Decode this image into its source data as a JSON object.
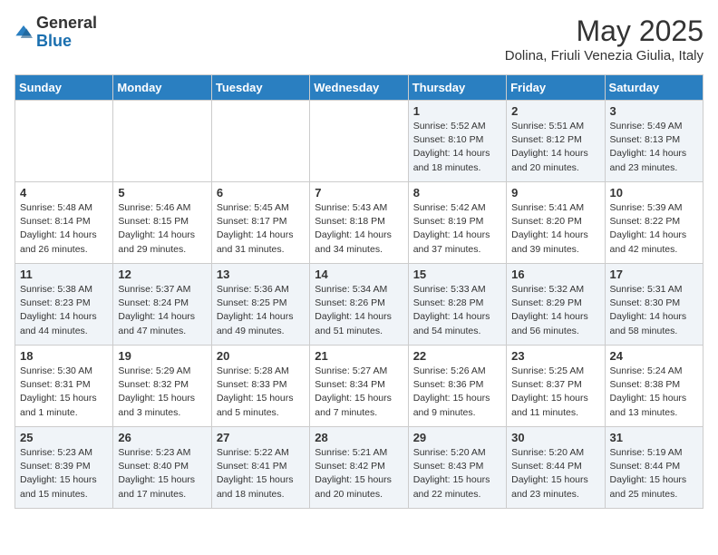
{
  "logo": {
    "general": "General",
    "blue": "Blue"
  },
  "title": "May 2025",
  "subtitle": "Dolina, Friuli Venezia Giulia, Italy",
  "days_of_week": [
    "Sunday",
    "Monday",
    "Tuesday",
    "Wednesday",
    "Thursday",
    "Friday",
    "Saturday"
  ],
  "weeks": [
    [
      {
        "day": "",
        "content": ""
      },
      {
        "day": "",
        "content": ""
      },
      {
        "day": "",
        "content": ""
      },
      {
        "day": "",
        "content": ""
      },
      {
        "day": "1",
        "content": "Sunrise: 5:52 AM\nSunset: 8:10 PM\nDaylight: 14 hours\nand 18 minutes."
      },
      {
        "day": "2",
        "content": "Sunrise: 5:51 AM\nSunset: 8:12 PM\nDaylight: 14 hours\nand 20 minutes."
      },
      {
        "day": "3",
        "content": "Sunrise: 5:49 AM\nSunset: 8:13 PM\nDaylight: 14 hours\nand 23 minutes."
      }
    ],
    [
      {
        "day": "4",
        "content": "Sunrise: 5:48 AM\nSunset: 8:14 PM\nDaylight: 14 hours\nand 26 minutes."
      },
      {
        "day": "5",
        "content": "Sunrise: 5:46 AM\nSunset: 8:15 PM\nDaylight: 14 hours\nand 29 minutes."
      },
      {
        "day": "6",
        "content": "Sunrise: 5:45 AM\nSunset: 8:17 PM\nDaylight: 14 hours\nand 31 minutes."
      },
      {
        "day": "7",
        "content": "Sunrise: 5:43 AM\nSunset: 8:18 PM\nDaylight: 14 hours\nand 34 minutes."
      },
      {
        "day": "8",
        "content": "Sunrise: 5:42 AM\nSunset: 8:19 PM\nDaylight: 14 hours\nand 37 minutes."
      },
      {
        "day": "9",
        "content": "Sunrise: 5:41 AM\nSunset: 8:20 PM\nDaylight: 14 hours\nand 39 minutes."
      },
      {
        "day": "10",
        "content": "Sunrise: 5:39 AM\nSunset: 8:22 PM\nDaylight: 14 hours\nand 42 minutes."
      }
    ],
    [
      {
        "day": "11",
        "content": "Sunrise: 5:38 AM\nSunset: 8:23 PM\nDaylight: 14 hours\nand 44 minutes."
      },
      {
        "day": "12",
        "content": "Sunrise: 5:37 AM\nSunset: 8:24 PM\nDaylight: 14 hours\nand 47 minutes."
      },
      {
        "day": "13",
        "content": "Sunrise: 5:36 AM\nSunset: 8:25 PM\nDaylight: 14 hours\nand 49 minutes."
      },
      {
        "day": "14",
        "content": "Sunrise: 5:34 AM\nSunset: 8:26 PM\nDaylight: 14 hours\nand 51 minutes."
      },
      {
        "day": "15",
        "content": "Sunrise: 5:33 AM\nSunset: 8:28 PM\nDaylight: 14 hours\nand 54 minutes."
      },
      {
        "day": "16",
        "content": "Sunrise: 5:32 AM\nSunset: 8:29 PM\nDaylight: 14 hours\nand 56 minutes."
      },
      {
        "day": "17",
        "content": "Sunrise: 5:31 AM\nSunset: 8:30 PM\nDaylight: 14 hours\nand 58 minutes."
      }
    ],
    [
      {
        "day": "18",
        "content": "Sunrise: 5:30 AM\nSunset: 8:31 PM\nDaylight: 15 hours\nand 1 minute."
      },
      {
        "day": "19",
        "content": "Sunrise: 5:29 AM\nSunset: 8:32 PM\nDaylight: 15 hours\nand 3 minutes."
      },
      {
        "day": "20",
        "content": "Sunrise: 5:28 AM\nSunset: 8:33 PM\nDaylight: 15 hours\nand 5 minutes."
      },
      {
        "day": "21",
        "content": "Sunrise: 5:27 AM\nSunset: 8:34 PM\nDaylight: 15 hours\nand 7 minutes."
      },
      {
        "day": "22",
        "content": "Sunrise: 5:26 AM\nSunset: 8:36 PM\nDaylight: 15 hours\nand 9 minutes."
      },
      {
        "day": "23",
        "content": "Sunrise: 5:25 AM\nSunset: 8:37 PM\nDaylight: 15 hours\nand 11 minutes."
      },
      {
        "day": "24",
        "content": "Sunrise: 5:24 AM\nSunset: 8:38 PM\nDaylight: 15 hours\nand 13 minutes."
      }
    ],
    [
      {
        "day": "25",
        "content": "Sunrise: 5:23 AM\nSunset: 8:39 PM\nDaylight: 15 hours\nand 15 minutes."
      },
      {
        "day": "26",
        "content": "Sunrise: 5:23 AM\nSunset: 8:40 PM\nDaylight: 15 hours\nand 17 minutes."
      },
      {
        "day": "27",
        "content": "Sunrise: 5:22 AM\nSunset: 8:41 PM\nDaylight: 15 hours\nand 18 minutes."
      },
      {
        "day": "28",
        "content": "Sunrise: 5:21 AM\nSunset: 8:42 PM\nDaylight: 15 hours\nand 20 minutes."
      },
      {
        "day": "29",
        "content": "Sunrise: 5:20 AM\nSunset: 8:43 PM\nDaylight: 15 hours\nand 22 minutes."
      },
      {
        "day": "30",
        "content": "Sunrise: 5:20 AM\nSunset: 8:44 PM\nDaylight: 15 hours\nand 23 minutes."
      },
      {
        "day": "31",
        "content": "Sunrise: 5:19 AM\nSunset: 8:44 PM\nDaylight: 15 hours\nand 25 minutes."
      }
    ]
  ]
}
